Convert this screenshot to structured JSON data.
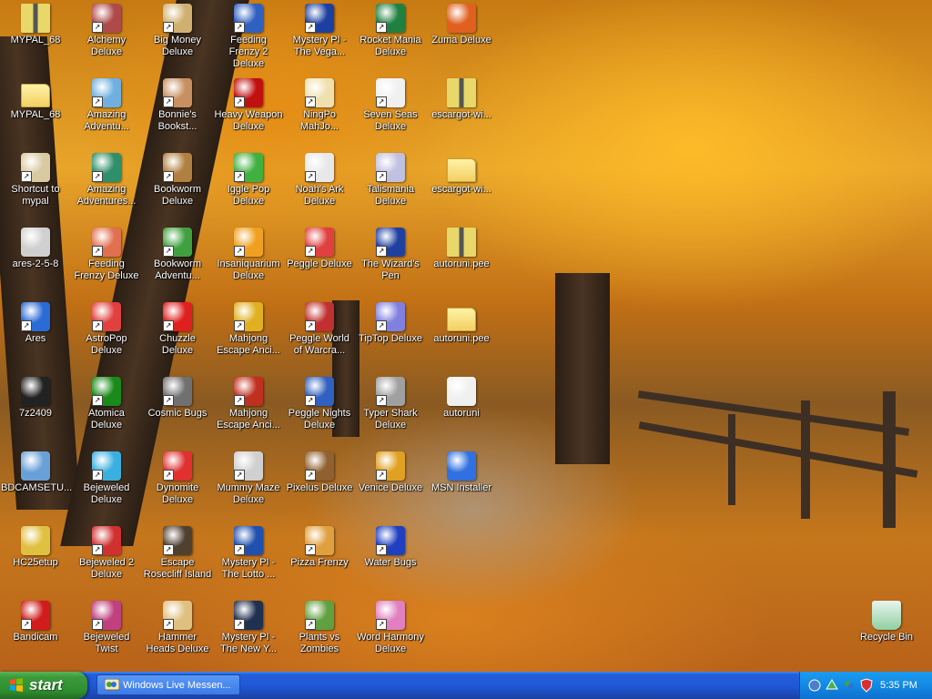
{
  "desktop_icons": [
    {
      "label": "MYPAL_68",
      "color": "#e8d86a",
      "type": "zip"
    },
    {
      "label": "MYPAL_68",
      "color": "#f3d062",
      "type": "folder"
    },
    {
      "label": "Shortcut to mypal",
      "color": "#d9c9a0",
      "type": "shortcut"
    },
    {
      "label": "ares-2-5-8",
      "color": "#d0d0d0",
      "type": "app"
    },
    {
      "label": "Ares",
      "color": "#2a6bd6",
      "type": "shortcut"
    },
    {
      "label": "7z2409",
      "color": "#222222",
      "type": "app"
    },
    {
      "label": "BDCAMSETU...",
      "color": "#6aa0d8",
      "type": "app"
    },
    {
      "label": "HC25etup",
      "color": "#e0c040",
      "type": "app"
    },
    {
      "label": "Bandicam",
      "color": "#d01c1c",
      "type": "shortcut"
    },
    {
      "label": "Alchemy Deluxe",
      "color": "#b04a4a",
      "type": "shortcut"
    },
    {
      "label": "Amazing Adventu...",
      "color": "#6fb0e0",
      "type": "shortcut"
    },
    {
      "label": "Amazing Adventures...",
      "color": "#2f8f6a",
      "type": "shortcut"
    },
    {
      "label": "Feeding Frenzy Deluxe",
      "color": "#e07050",
      "type": "shortcut"
    },
    {
      "label": "AstroPop Deluxe",
      "color": "#e04040",
      "type": "shortcut"
    },
    {
      "label": "Atomica Deluxe",
      "color": "#1a8a1a",
      "type": "shortcut"
    },
    {
      "label": "Bejeweled Deluxe",
      "color": "#3ab0e0",
      "type": "shortcut"
    },
    {
      "label": "Bejeweled 2 Deluxe",
      "color": "#d03030",
      "type": "shortcut"
    },
    {
      "label": "Bejeweled Twist",
      "color": "#c04080",
      "type": "shortcut"
    },
    {
      "label": "Big Money Deluxe",
      "color": "#d0b070",
      "type": "shortcut"
    },
    {
      "label": "Bonnie's Bookst...",
      "color": "#c89060",
      "type": "shortcut"
    },
    {
      "label": "Bookworm Deluxe",
      "color": "#b08040",
      "type": "shortcut"
    },
    {
      "label": "Bookworm Adventu...",
      "color": "#40a040",
      "type": "shortcut"
    },
    {
      "label": "Chuzzle Deluxe",
      "color": "#e02020",
      "type": "shortcut"
    },
    {
      "label": "Cosmic Bugs",
      "color": "#707070",
      "type": "shortcut"
    },
    {
      "label": "Dynomite Deluxe",
      "color": "#e03030",
      "type": "shortcut"
    },
    {
      "label": "Escape Rosecliff Island",
      "color": "#504030",
      "type": "shortcut"
    },
    {
      "label": "Hammer Heads Deluxe",
      "color": "#e0c080",
      "type": "shortcut"
    },
    {
      "label": "Feeding Frenzy 2 Deluxe",
      "color": "#3060c0",
      "type": "shortcut"
    },
    {
      "label": "Heavy Weapon Deluxe",
      "color": "#c01010",
      "type": "shortcut"
    },
    {
      "label": "Iggle Pop Deluxe",
      "color": "#40b040",
      "type": "shortcut"
    },
    {
      "label": "Insaniquarium Deluxe",
      "color": "#f0a020",
      "type": "shortcut"
    },
    {
      "label": "Mahjong Escape Anci...",
      "color": "#e0b020",
      "type": "shortcut"
    },
    {
      "label": "Mahjong Escape Anci...",
      "color": "#c03020",
      "type": "shortcut"
    },
    {
      "label": "Mummy Maze Deluxe",
      "color": "#d0d0d0",
      "type": "shortcut"
    },
    {
      "label": "Mystery PI - The Lotto ...",
      "color": "#2050b0",
      "type": "shortcut"
    },
    {
      "label": "Mystery PI - The New Y...",
      "color": "#203050",
      "type": "shortcut"
    },
    {
      "label": "Mystery PI - The Vega...",
      "color": "#1c40a0",
      "type": "shortcut"
    },
    {
      "label": "NingPo MahJo...",
      "color": "#f0e0b0",
      "type": "shortcut"
    },
    {
      "label": "Noah's Ark Deluxe",
      "color": "#e8e8e8",
      "type": "shortcut"
    },
    {
      "label": "Peggle Deluxe",
      "color": "#e04040",
      "type": "shortcut"
    },
    {
      "label": "Peggle World of Warcra...",
      "color": "#c03030",
      "type": "shortcut"
    },
    {
      "label": "Peggle Nights Deluxe",
      "color": "#3060c0",
      "type": "shortcut"
    },
    {
      "label": "Pixelus Deluxe",
      "color": "#906030",
      "type": "shortcut"
    },
    {
      "label": "Pizza Frenzy",
      "color": "#e0a040",
      "type": "shortcut"
    },
    {
      "label": "Plants vs Zombies",
      "color": "#60a040",
      "type": "shortcut"
    },
    {
      "label": "Rocket Mania Deluxe",
      "color": "#208040",
      "type": "shortcut"
    },
    {
      "label": "Seven Seas Deluxe",
      "color": "#f0f0f0",
      "type": "shortcut"
    },
    {
      "label": "Talismania Deluxe",
      "color": "#c0c0e0",
      "type": "shortcut"
    },
    {
      "label": "The Wizard's Pen",
      "color": "#2040a0",
      "type": "shortcut"
    },
    {
      "label": "TipTop Deluxe",
      "color": "#8080e0",
      "type": "shortcut"
    },
    {
      "label": "Typer Shark Deluxe",
      "color": "#a0a0a0",
      "type": "shortcut"
    },
    {
      "label": "Venice Deluxe",
      "color": "#e0a020",
      "type": "shortcut"
    },
    {
      "label": "Water Bugs",
      "color": "#2040c0",
      "type": "shortcut"
    },
    {
      "label": "Word Harmony Deluxe",
      "color": "#e080c0",
      "type": "shortcut"
    },
    {
      "label": "Zuma Deluxe",
      "color": "#e06020",
      "type": "app"
    },
    {
      "label": "escargot-wi...",
      "color": "#e8d86a",
      "type": "zip"
    },
    {
      "label": "escargot-wi...",
      "color": "#f3d062",
      "type": "folder"
    },
    {
      "label": "autoruni.pee",
      "color": "#e8d86a",
      "type": "zip"
    },
    {
      "label": "autoruni.pee",
      "color": "#f3d062",
      "type": "folder"
    },
    {
      "label": "autoruni",
      "color": "#f0f0f0",
      "type": "app"
    },
    {
      "label": "MSN Installer",
      "color": "#3070e0",
      "type": "app"
    }
  ],
  "recycle_bin": {
    "label": "Recycle Bin",
    "color": "#8fd0a0"
  },
  "taskbar": {
    "start_label": "start",
    "task_item_label": "Windows Live Messen...",
    "clock": "5:35 PM"
  }
}
